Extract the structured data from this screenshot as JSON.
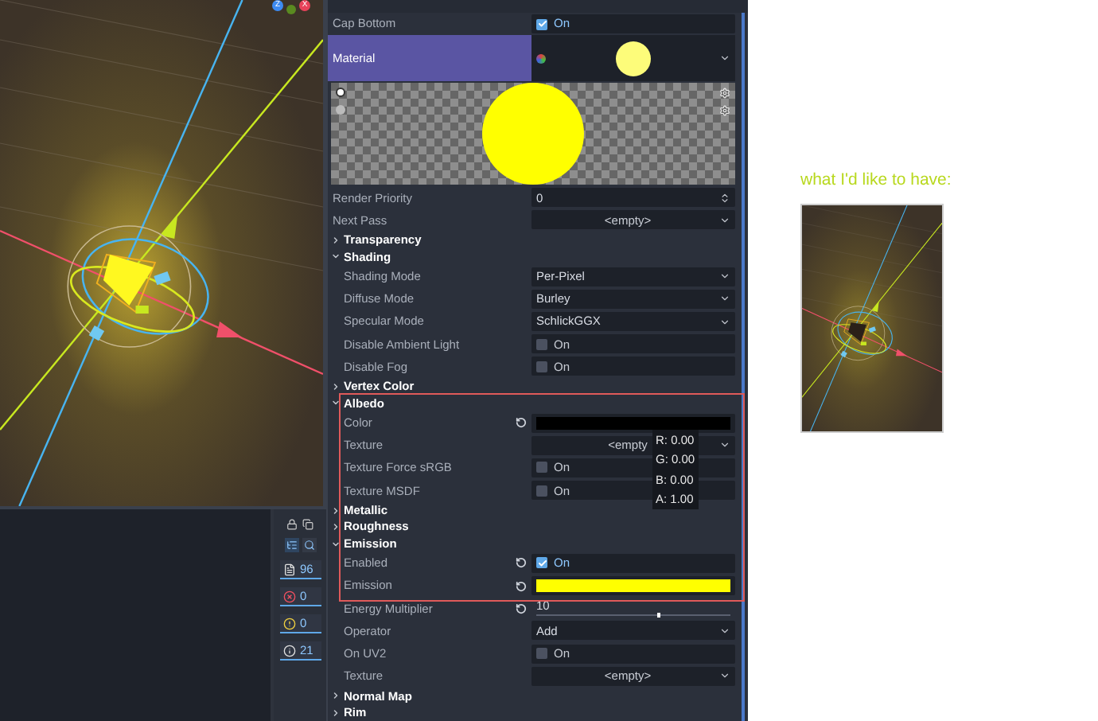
{
  "viewport": {
    "gizmo_axes": [
      {
        "label": "Z",
        "color": "#3d8bf2"
      },
      {
        "label": "X",
        "color": "#e8425a"
      }
    ]
  },
  "console": {
    "filters": [
      {
        "kind": "message",
        "count": "96"
      },
      {
        "kind": "error",
        "count": "0"
      },
      {
        "kind": "warning",
        "count": "0"
      },
      {
        "kind": "info",
        "count": "21"
      }
    ]
  },
  "inspector": {
    "rows": [
      {
        "kind": "check",
        "label": "Cap Bottom",
        "checked": true,
        "value": "On"
      },
      {
        "kind": "material",
        "label": "Material"
      },
      {
        "kind": "preview"
      },
      {
        "kind": "spin",
        "label": "Render Priority",
        "value": "0"
      },
      {
        "kind": "resource",
        "label": "Next Pass",
        "value": "<empty>"
      },
      {
        "kind": "section",
        "label": "Transparency",
        "expanded": false
      },
      {
        "kind": "section",
        "label": "Shading",
        "expanded": true,
        "children": [
          {
            "kind": "select",
            "label": "Shading Mode",
            "value": "Per-Pixel"
          },
          {
            "kind": "select",
            "label": "Diffuse Mode",
            "value": "Burley"
          },
          {
            "kind": "select",
            "label": "Specular Mode",
            "value": "SchlickGGX"
          },
          {
            "kind": "check",
            "label": "Disable Ambient Light",
            "checked": false,
            "value": "On"
          },
          {
            "kind": "check",
            "label": "Disable Fog",
            "checked": false,
            "value": "On"
          }
        ]
      },
      {
        "kind": "section",
        "label": "Vertex Color",
        "expanded": false
      },
      {
        "kind": "section",
        "label": "Albedo",
        "expanded": true,
        "children": [
          {
            "kind": "color",
            "label": "Color",
            "revert": true,
            "color": "#000000"
          },
          {
            "kind": "resource",
            "label": "Texture",
            "value": "<empty"
          },
          {
            "kind": "check",
            "label": "Texture Force sRGB",
            "checked": false,
            "value": "On"
          },
          {
            "kind": "check",
            "label": "Texture MSDF",
            "checked": false,
            "value": "On"
          }
        ]
      },
      {
        "kind": "section",
        "label": "Metallic",
        "expanded": false
      },
      {
        "kind": "section",
        "label": "Roughness",
        "expanded": false
      },
      {
        "kind": "section",
        "label": "Emission",
        "expanded": true,
        "children": [
          {
            "kind": "check",
            "label": "Enabled",
            "revert": true,
            "checked": true,
            "value": "On"
          },
          {
            "kind": "color",
            "label": "Emission",
            "revert": true,
            "color": "#ffff00"
          },
          {
            "kind": "slider",
            "label": "Energy Multiplier",
            "revert": true,
            "value": "10",
            "level": 0.62
          },
          {
            "kind": "select",
            "label": "Operator",
            "value": "Add"
          },
          {
            "kind": "check",
            "label": "On UV2",
            "checked": false,
            "value": "On"
          },
          {
            "kind": "resource",
            "label": "Texture",
            "value": "<empty>"
          }
        ]
      },
      {
        "kind": "section",
        "label": "Normal Map",
        "expanded": false
      },
      {
        "kind": "section",
        "label": "Rim",
        "expanded": false
      }
    ]
  },
  "tooltip": [
    "R: 0.00",
    "G: 0.00",
    "B: 0.00",
    "A: 1.00"
  ],
  "note": {
    "text": "what I'd like to have:"
  }
}
